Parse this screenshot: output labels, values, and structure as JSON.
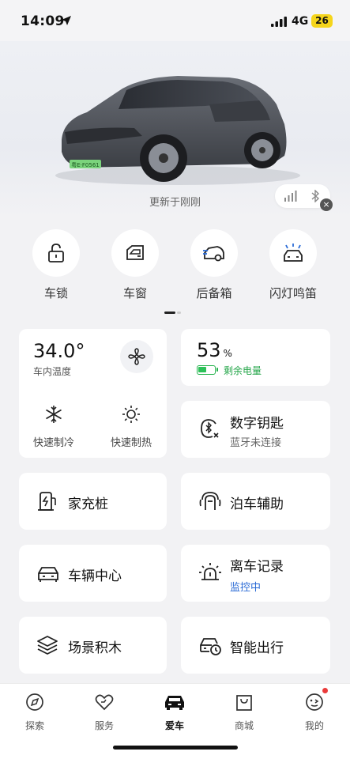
{
  "status_bar": {
    "time": "14:09",
    "network": "4G",
    "battery": "26"
  },
  "hero": {
    "updated_text": "更新于刚刚",
    "plate_text": "粤E·F0561"
  },
  "quick_controls": [
    {
      "label": "车锁",
      "icon": "lock-icon"
    },
    {
      "label": "车窗",
      "icon": "window-icon"
    },
    {
      "label": "后备箱",
      "icon": "trunk-icon"
    },
    {
      "label": "闪灯鸣笛",
      "icon": "flash-horn-icon"
    }
  ],
  "climate": {
    "temperature": "34.0°",
    "temperature_label": "车内温度",
    "fan_icon": "fan-icon",
    "actions": [
      {
        "label": "快速制冷",
        "icon": "snowflake-icon"
      },
      {
        "label": "快速制热",
        "icon": "sun-icon"
      }
    ]
  },
  "battery_card": {
    "value": "53",
    "unit": "%",
    "label": "剩余电量",
    "level_fraction": 0.53,
    "color": "#23b24b"
  },
  "features": {
    "digital_key": {
      "title": "数字钥匙",
      "sub": "蓝牙未连接"
    },
    "home_charger": {
      "title": "家充桩"
    },
    "parking_assist": {
      "title": "泊车辅助"
    },
    "vehicle_center": {
      "title": "车辆中心"
    },
    "departure_record": {
      "title": "离车记录",
      "sub": "监控中",
      "sub_color": "#2b6bd6"
    },
    "scene_blocks": {
      "title": "场景积木"
    },
    "smart_travel": {
      "title": "智能出行"
    }
  },
  "tabbar": [
    {
      "label": "探索",
      "icon": "explore-icon"
    },
    {
      "label": "服务",
      "icon": "service-icon"
    },
    {
      "label": "爱车",
      "icon": "car-icon",
      "active": true
    },
    {
      "label": "商城",
      "icon": "shop-icon"
    },
    {
      "label": "我的",
      "icon": "profile-icon"
    }
  ]
}
